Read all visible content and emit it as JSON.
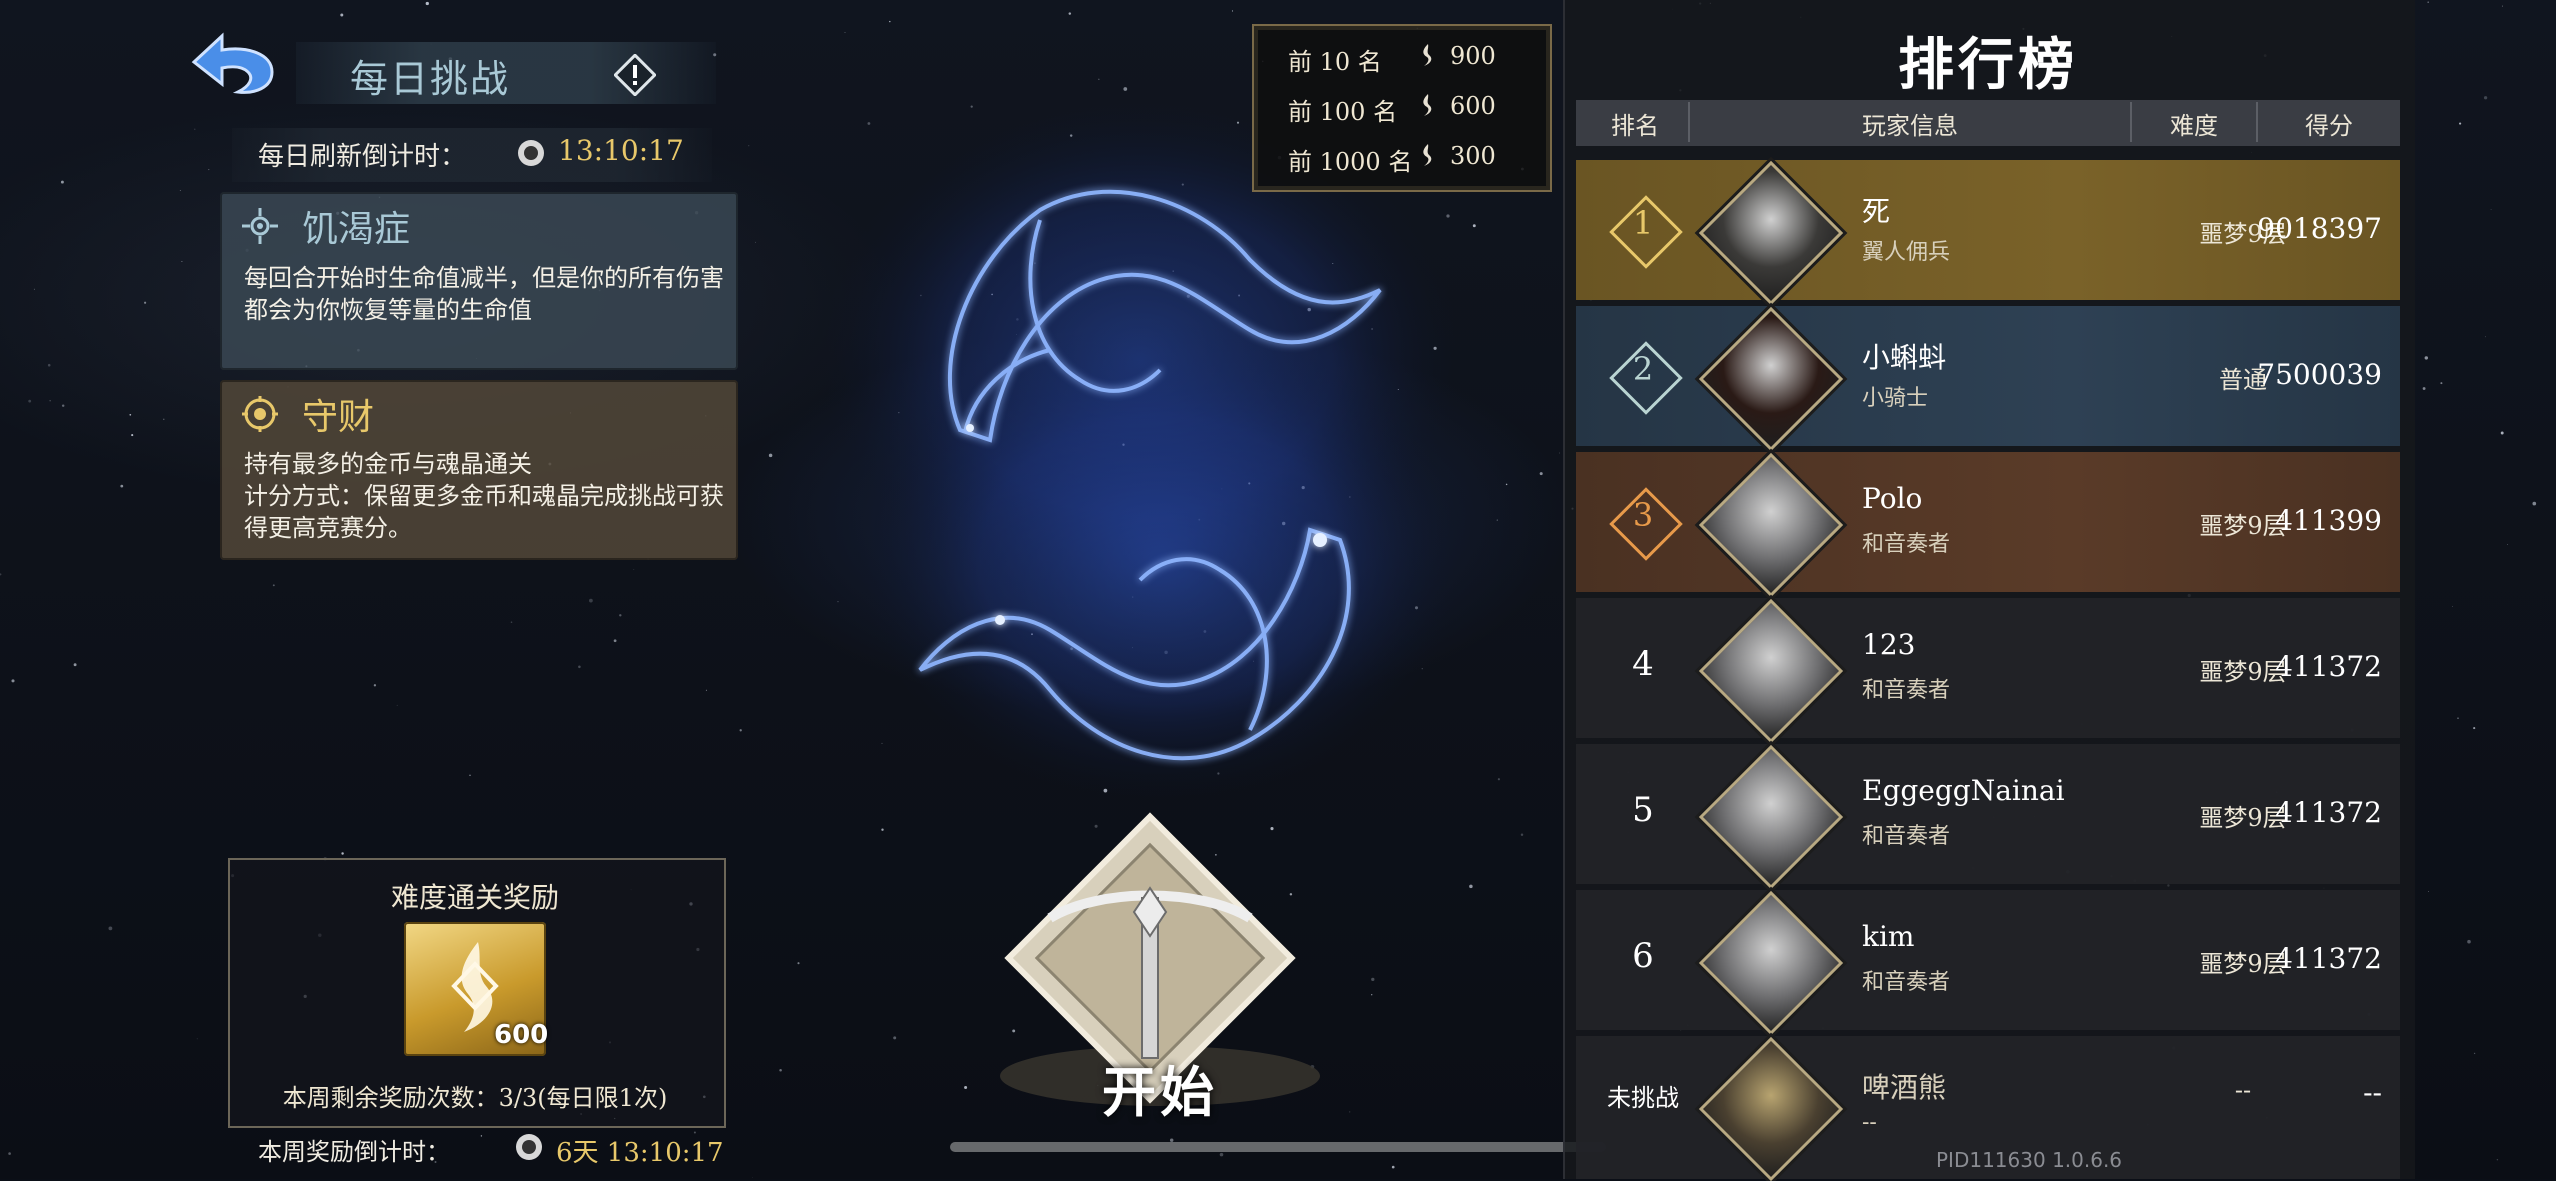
{
  "header": {
    "title": "每日挑战",
    "refresh_label": "每日刷新倒计时：",
    "refresh_time": "13:10:17"
  },
  "modifiers": [
    {
      "name": "饥渴症",
      "desc_line1": "每回合开始时生命值减半，但是你的所有伤害",
      "desc_line2": "都会为你恢复等量的生命值",
      "color": "#a9c9d6"
    },
    {
      "name": "守财",
      "desc_line1": "持有最多的金币与魂晶通关",
      "desc_line2": "计分方式：保留更多金币和魂晶完成挑战可获",
      "desc_line3": "得更高竞赛分。",
      "color": "#e8c86a"
    }
  ],
  "difficulty_reward": {
    "title": "难度通关奖励",
    "amount": "600",
    "remaining": "本周剩余奖励次数：3/3(每日限1次)",
    "week_label": "本周奖励倒计时：",
    "week_time": "6天 13:10:17"
  },
  "rank_rewards": [
    {
      "label": "前 10 名",
      "value": "900"
    },
    {
      "label": "前 100 名",
      "value": "600"
    },
    {
      "label": "前 1000 名",
      "value": "300"
    }
  ],
  "start_button": {
    "label": "开始"
  },
  "leaderboard": {
    "title": "排行榜",
    "columns": {
      "rank": "排名",
      "player": "玩家信息",
      "difficulty": "难度",
      "score": "得分"
    },
    "rows": [
      {
        "rank": "1",
        "name": "死",
        "title": "翼人佣兵",
        "difficulty": "噩梦9层",
        "score": "9018397",
        "style": "gold"
      },
      {
        "rank": "2",
        "name": "小蝌蚪",
        "title": "小骑士",
        "difficulty": "普通",
        "score": "7500039",
        "style": "blue"
      },
      {
        "rank": "3",
        "name": "Polo",
        "title": "和音奏者",
        "difficulty": "噩梦9层",
        "score": "411399",
        "style": "bronze"
      },
      {
        "rank": "4",
        "name": "123",
        "title": "和音奏者",
        "difficulty": "噩梦9层",
        "score": "411372",
        "style": "dark"
      },
      {
        "rank": "5",
        "name": "EggeggNainai",
        "title": "和音奏者",
        "difficulty": "噩梦9层",
        "score": "411372",
        "style": "dark"
      },
      {
        "rank": "6",
        "name": "kim",
        "title": "和音奏者",
        "difficulty": "噩梦9层",
        "score": "411372",
        "style": "dark"
      }
    ],
    "self_row": {
      "rank": "未挑战",
      "name": "啤酒熊",
      "title": "--",
      "difficulty": "--",
      "score": "--"
    }
  },
  "version": "PID111630  1.0.6.6",
  "colors": {
    "gold_rank": "#e8c86a",
    "silver_rank": "#b9d4d2",
    "bronze_rank": "#e89a4a",
    "accent_blue": "#3c6ad8"
  }
}
